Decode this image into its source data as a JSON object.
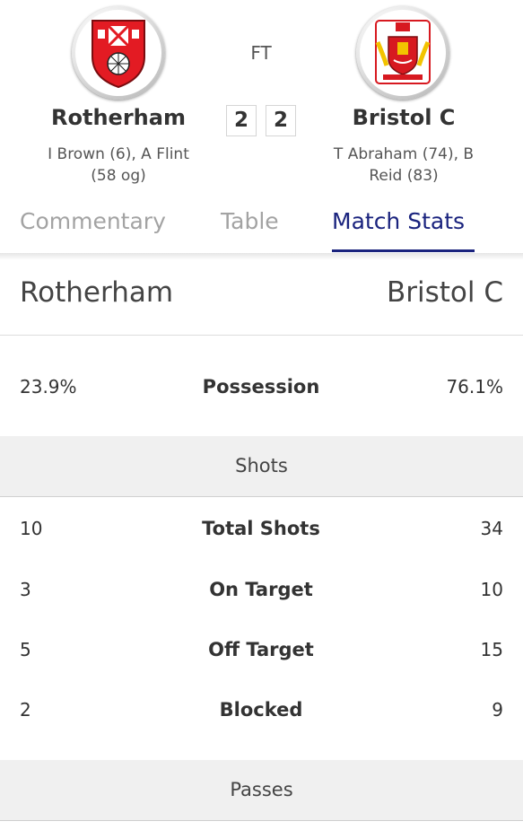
{
  "match": {
    "status": "FT",
    "home": {
      "name": "Rotherham",
      "score": "2",
      "scorers": "I Brown (6), A Flint (58 og)",
      "badge_icon": "rotherham-crest-icon",
      "badge_color": "#e31b23"
    },
    "away": {
      "name": "Bristol C",
      "score": "2",
      "scorers": "T Abraham (74), B Reid (83)",
      "badge_icon": "bristol-city-crest-icon",
      "badge_color": "#d71920"
    }
  },
  "tabs": [
    {
      "label": "Commentary",
      "active": false
    },
    {
      "label": "Table",
      "active": false
    },
    {
      "label": "Match Stats",
      "active": true
    }
  ],
  "colors": {
    "active_tab": "#1a237e",
    "inactive_tab": "#a3a3a3"
  },
  "stats": {
    "team_home": "Rotherham",
    "team_away": "Bristol C",
    "possession": {
      "label": "Possession",
      "home": "23.9%",
      "away": "76.1%"
    },
    "sections": [
      {
        "title": "Shots",
        "rows": [
          {
            "label": "Total Shots",
            "home": "10",
            "away": "34"
          },
          {
            "label": "On Target",
            "home": "3",
            "away": "10"
          },
          {
            "label": "Off Target",
            "home": "5",
            "away": "15"
          },
          {
            "label": "Blocked",
            "home": "2",
            "away": "9"
          }
        ]
      },
      {
        "title": "Passes",
        "rows": []
      }
    ]
  }
}
